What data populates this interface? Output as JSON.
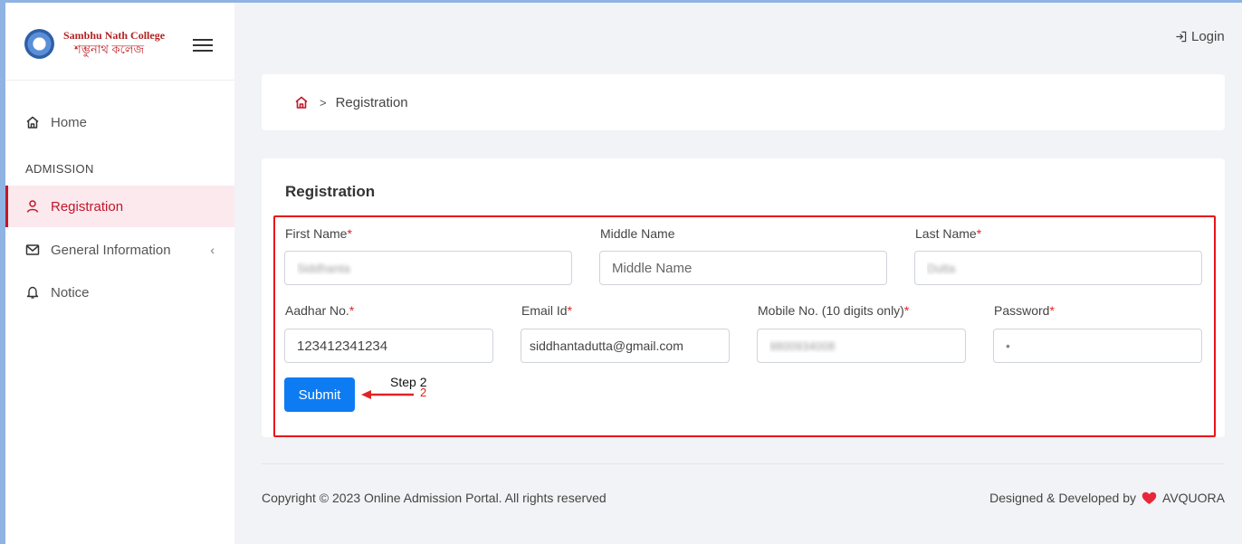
{
  "sidebar": {
    "logo_en": "Sambhu Nath College",
    "logo_bn": "শম্ভুনাথ কলেজ",
    "home_label": "Home",
    "section_label": "ADMISSION",
    "items": [
      {
        "label": "Registration",
        "active": true
      },
      {
        "label": "General Information",
        "active": false
      },
      {
        "label": "Notice",
        "active": false
      }
    ]
  },
  "header": {
    "login_label": "Login"
  },
  "breadcrumb": {
    "separator": ">",
    "current": "Registration"
  },
  "form": {
    "title": "Registration",
    "required_mark": "*",
    "fields": {
      "first_name": {
        "label": "First Name",
        "value": "Siddhanta"
      },
      "middle_name": {
        "label": "Middle Name",
        "placeholder": "Middle Name"
      },
      "last_name": {
        "label": "Last Name",
        "value": "Dutta"
      },
      "aadhar": {
        "label": "Aadhar No.",
        "value": "123412341234"
      },
      "email": {
        "label": "Email Id",
        "value": "siddhantadutta@gmail.com"
      },
      "mobile": {
        "label": "Mobile No. (10 digits only)",
        "value": "9800934008"
      },
      "password": {
        "label": "Password",
        "value": "•"
      }
    },
    "submit_label": "Submit"
  },
  "annotation": {
    "step_label": "Step 2",
    "step_number": "2"
  },
  "footer": {
    "copyright": "Copyright © 2023 Online Admission Portal. All rights reserved",
    "designed_prefix": "Designed & Developed by",
    "designed_brand": "AVQUORA"
  },
  "colors": {
    "accent": "#c0172a",
    "primary_button": "#0d7cf2",
    "highlight_box": "#e8151b"
  }
}
